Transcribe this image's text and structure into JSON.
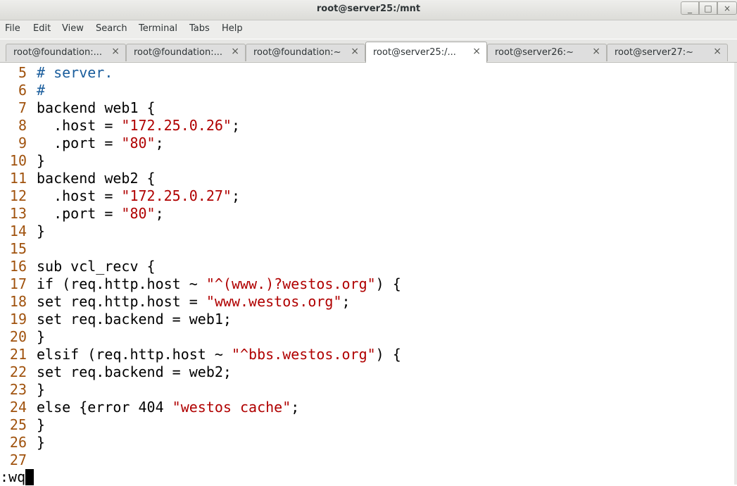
{
  "window": {
    "title": "root@server25:/mnt"
  },
  "window_controls": {
    "minimize": "_",
    "maximize": "□",
    "close": "×"
  },
  "menu": [
    "File",
    "Edit",
    "View",
    "Search",
    "Terminal",
    "Tabs",
    "Help"
  ],
  "tabs": [
    {
      "label": "root@foundation:...",
      "active": false
    },
    {
      "label": "root@foundation:...",
      "active": false
    },
    {
      "label": "root@foundation:~",
      "active": false
    },
    {
      "label": "root@server25:/...",
      "active": true
    },
    {
      "label": "root@server26:~",
      "active": false
    },
    {
      "label": "root@server27:~",
      "active": false
    }
  ],
  "tab_close_glyph": "×",
  "editor": {
    "lines": [
      {
        "num": "5",
        "segs": [
          [
            "cmt",
            "# server."
          ]
        ]
      },
      {
        "num": "6",
        "segs": [
          [
            "cmt",
            "#"
          ]
        ]
      },
      {
        "num": "7",
        "segs": [
          [
            "",
            "backend web1 {"
          ]
        ]
      },
      {
        "num": "8",
        "segs": [
          [
            "",
            "  .host = "
          ],
          [
            "str",
            "\"172.25.0.26\""
          ],
          [
            "",
            ";"
          ]
        ]
      },
      {
        "num": "9",
        "segs": [
          [
            "",
            "  .port = "
          ],
          [
            "str",
            "\"80\""
          ],
          [
            "",
            ";"
          ]
        ]
      },
      {
        "num": "10",
        "segs": [
          [
            "",
            "}"
          ]
        ]
      },
      {
        "num": "11",
        "segs": [
          [
            "",
            "backend web2 {"
          ]
        ]
      },
      {
        "num": "12",
        "segs": [
          [
            "",
            "  .host = "
          ],
          [
            "str",
            "\"172.25.0.27\""
          ],
          [
            "",
            ";"
          ]
        ]
      },
      {
        "num": "13",
        "segs": [
          [
            "",
            "  .port = "
          ],
          [
            "str",
            "\"80\""
          ],
          [
            "",
            ";"
          ]
        ]
      },
      {
        "num": "14",
        "segs": [
          [
            "",
            "}"
          ]
        ]
      },
      {
        "num": "15",
        "segs": []
      },
      {
        "num": "16",
        "segs": [
          [
            "",
            "sub vcl_recv {"
          ]
        ]
      },
      {
        "num": "17",
        "segs": [
          [
            "",
            "if (req.http.host ~ "
          ],
          [
            "str",
            "\"^(www.)?westos.org\""
          ],
          [
            "",
            ") {"
          ]
        ]
      },
      {
        "num": "18",
        "segs": [
          [
            "",
            "set req.http.host = "
          ],
          [
            "str",
            "\"www.westos.org\""
          ],
          [
            "",
            ";"
          ]
        ]
      },
      {
        "num": "19",
        "segs": [
          [
            "",
            "set req.backend = web1;"
          ]
        ]
      },
      {
        "num": "20",
        "segs": [
          [
            "",
            "}"
          ]
        ]
      },
      {
        "num": "21",
        "segs": [
          [
            "",
            "elsif (req.http.host ~ "
          ],
          [
            "str",
            "\"^bbs.westos.org\""
          ],
          [
            "",
            ") {"
          ]
        ]
      },
      {
        "num": "22",
        "segs": [
          [
            "",
            "set req.backend = web2;"
          ]
        ]
      },
      {
        "num": "23",
        "segs": [
          [
            "",
            "}"
          ]
        ]
      },
      {
        "num": "24",
        "segs": [
          [
            "",
            "else {error 404 "
          ],
          [
            "str",
            "\"westos cache\""
          ],
          [
            "",
            ";"
          ]
        ]
      },
      {
        "num": "25",
        "segs": [
          [
            "",
            "}"
          ]
        ]
      },
      {
        "num": "26",
        "segs": [
          [
            "",
            "}"
          ]
        ]
      },
      {
        "num": "27",
        "segs": []
      }
    ],
    "command_line": ":wq"
  }
}
